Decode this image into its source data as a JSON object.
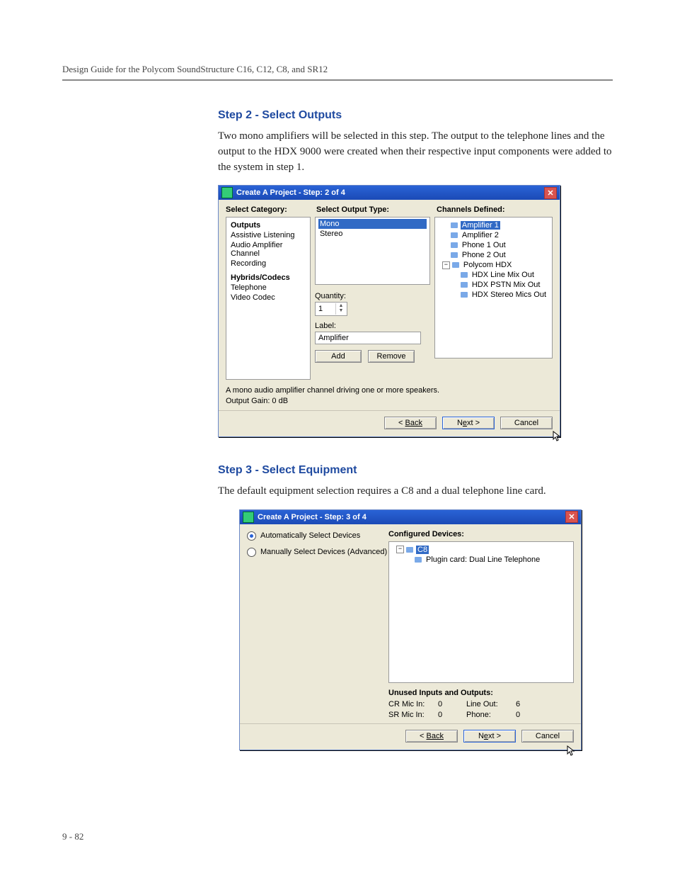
{
  "runningHead": "Design Guide for the Polycom SoundStructure C16, C12, C8, and SR12",
  "pageNum": "9 - 82",
  "step2": {
    "title": "Step 2 - Select Outputs",
    "text": "Two mono amplifiers will be selected in this step. The output to the telephone lines and the output to the HDX 9000 were created when their respective input components were added to the system in step 1."
  },
  "dialog1": {
    "title": "Create A Project - Step: 2 of 4",
    "headers": {
      "cat": "Select Category:",
      "type": "Select Output Type:",
      "chan": "Channels Defined:"
    },
    "categories": [
      {
        "t": "Outputs",
        "bold": true
      },
      {
        "t": "Assistive Listening",
        "bold": false
      },
      {
        "t": "Audio Amplifier Channel",
        "bold": false
      },
      {
        "t": "Recording",
        "bold": false
      },
      {
        "t": "Hybrids/Codecs",
        "bold": true
      },
      {
        "t": "Telephone",
        "bold": false
      },
      {
        "t": "Video Codec",
        "bold": false
      }
    ],
    "types": [
      {
        "t": "Mono",
        "sel": true
      },
      {
        "t": "Stereo",
        "sel": false
      }
    ],
    "quantityLabel": "Quantity:",
    "quantity": "1",
    "labelLabel": "Label:",
    "labelValue": "Amplifier",
    "addBtn": "Add",
    "removeBtn": "Remove",
    "desc1": "A mono audio amplifier channel driving one or more speakers.",
    "desc2": "Output Gain: 0 dB",
    "channels": [
      {
        "indent": 0,
        "glyph": "",
        "label": "Amplifier 1",
        "sel": true
      },
      {
        "indent": 0,
        "glyph": "",
        "label": "Amplifier 2",
        "sel": false
      },
      {
        "indent": 0,
        "glyph": "",
        "label": "Phone 1 Out",
        "sel": false
      },
      {
        "indent": 0,
        "glyph": "",
        "label": "Phone 2 Out",
        "sel": false
      },
      {
        "indent": 0,
        "glyph": "-",
        "label": "Polycom HDX",
        "sel": false
      },
      {
        "indent": 1,
        "glyph": "",
        "label": "HDX Line Mix Out",
        "sel": false
      },
      {
        "indent": 1,
        "glyph": "",
        "label": "HDX PSTN Mix Out",
        "sel": false
      },
      {
        "indent": 1,
        "glyph": "",
        "label": "HDX Stereo Mics Out",
        "sel": false
      }
    ],
    "footer": {
      "back": "Back",
      "next": "Next >",
      "cancel": "Cancel"
    }
  },
  "step3": {
    "title": "Step 3 - Select Equipment",
    "text": "The default equipment selection requires a C8 and a dual telephone line card."
  },
  "dialog2": {
    "title": "Create A Project - Step: 3 of 4",
    "radios": [
      {
        "t": "Automatically Select Devices",
        "checked": true
      },
      {
        "t": "Manually Select Devices (Advanced)",
        "checked": false
      }
    ],
    "confLabel": "Configured Devices:",
    "tree": [
      {
        "indent": 0,
        "glyph": "-",
        "label": "C8",
        "sel": true
      },
      {
        "indent": 1,
        "glyph": "",
        "label": "Plugin card: Dual Line Telephone",
        "sel": false
      }
    ],
    "unusedLabel": "Unused Inputs and Outputs:",
    "unused": [
      {
        "k": "CR Mic In:",
        "v": "0"
      },
      {
        "k": "Line Out:",
        "v": "6"
      },
      {
        "k": "SR Mic In:",
        "v": "0"
      },
      {
        "k": "Phone:",
        "v": "0"
      }
    ],
    "footer": {
      "back": "Back",
      "next": "Next >",
      "cancel": "Cancel"
    }
  }
}
